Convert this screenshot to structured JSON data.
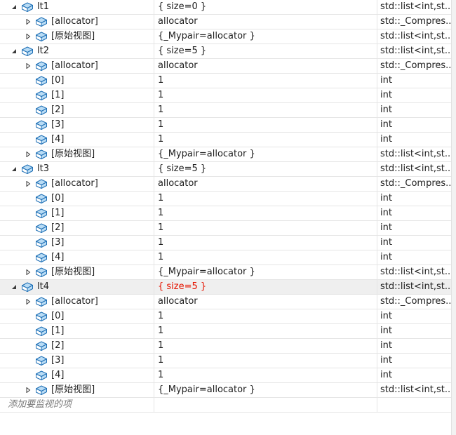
{
  "rows": [
    {
      "depth": 0,
      "expand": "open",
      "name": "lt1",
      "value": "{ size=0 }",
      "type": "std::list<int,st..."
    },
    {
      "depth": 1,
      "expand": "closed",
      "name": "[allocator]",
      "value": "allocator",
      "type": "std::_Compres..."
    },
    {
      "depth": 1,
      "expand": "closed",
      "name": "[原始视图]",
      "value": "{_Mypair=allocator }",
      "type": "std::list<int,st..."
    },
    {
      "depth": 0,
      "expand": "open",
      "name": "lt2",
      "value": "{ size=5 }",
      "type": "std::list<int,st..."
    },
    {
      "depth": 1,
      "expand": "closed",
      "name": "[allocator]",
      "value": "allocator",
      "type": "std::_Compres..."
    },
    {
      "depth": 1,
      "expand": "none",
      "name": "[0]",
      "value": "1",
      "type": "int"
    },
    {
      "depth": 1,
      "expand": "none",
      "name": "[1]",
      "value": "1",
      "type": "int"
    },
    {
      "depth": 1,
      "expand": "none",
      "name": "[2]",
      "value": "1",
      "type": "int"
    },
    {
      "depth": 1,
      "expand": "none",
      "name": "[3]",
      "value": "1",
      "type": "int"
    },
    {
      "depth": 1,
      "expand": "none",
      "name": "[4]",
      "value": "1",
      "type": "int"
    },
    {
      "depth": 1,
      "expand": "closed",
      "name": "[原始视图]",
      "value": "{_Mypair=allocator }",
      "type": "std::list<int,st..."
    },
    {
      "depth": 0,
      "expand": "open",
      "name": "lt3",
      "value": "{ size=5 }",
      "type": "std::list<int,st..."
    },
    {
      "depth": 1,
      "expand": "closed",
      "name": "[allocator]",
      "value": "allocator",
      "type": "std::_Compres..."
    },
    {
      "depth": 1,
      "expand": "none",
      "name": "[0]",
      "value": "1",
      "type": "int"
    },
    {
      "depth": 1,
      "expand": "none",
      "name": "[1]",
      "value": "1",
      "type": "int"
    },
    {
      "depth": 1,
      "expand": "none",
      "name": "[2]",
      "value": "1",
      "type": "int"
    },
    {
      "depth": 1,
      "expand": "none",
      "name": "[3]",
      "value": "1",
      "type": "int"
    },
    {
      "depth": 1,
      "expand": "none",
      "name": "[4]",
      "value": "1",
      "type": "int"
    },
    {
      "depth": 1,
      "expand": "closed",
      "name": "[原始视图]",
      "value": "{_Mypair=allocator }",
      "type": "std::list<int,st..."
    },
    {
      "depth": 0,
      "expand": "open",
      "name": "lt4",
      "value": "{ size=5 }",
      "type": "std::list<int,st...",
      "selected": true,
      "changed": true
    },
    {
      "depth": 1,
      "expand": "closed",
      "name": "[allocator]",
      "value": "allocator",
      "type": "std::_Compres..."
    },
    {
      "depth": 1,
      "expand": "none",
      "name": "[0]",
      "value": "1",
      "type": "int"
    },
    {
      "depth": 1,
      "expand": "none",
      "name": "[1]",
      "value": "1",
      "type": "int"
    },
    {
      "depth": 1,
      "expand": "none",
      "name": "[2]",
      "value": "1",
      "type": "int"
    },
    {
      "depth": 1,
      "expand": "none",
      "name": "[3]",
      "value": "1",
      "type": "int"
    },
    {
      "depth": 1,
      "expand": "none",
      "name": "[4]",
      "value": "1",
      "type": "int"
    },
    {
      "depth": 1,
      "expand": "closed",
      "name": "[原始视图]",
      "value": "{_Mypair=allocator }",
      "type": "std::list<int,st..."
    }
  ],
  "add_watch_placeholder": "添加要监视的项",
  "icon": "variable-icon",
  "colors": {
    "changed_value": "#e51400",
    "selected_row": "#efefef",
    "icon_fill": "#b9dcf5",
    "icon_stroke": "#1e6fb5"
  }
}
